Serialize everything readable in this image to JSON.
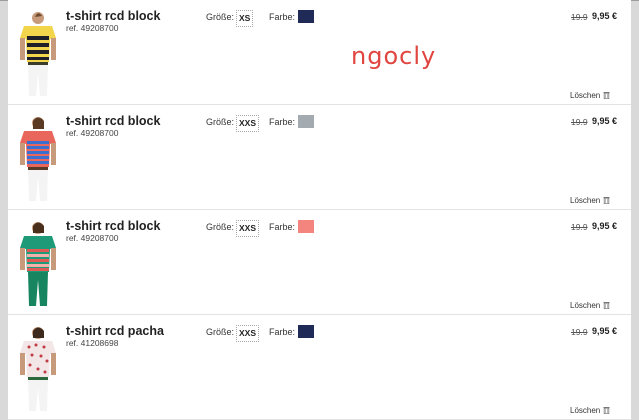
{
  "labels": {
    "size": "Größe:",
    "color": "Farbe:",
    "delete": "Löschen"
  },
  "watermark": "ngocly",
  "items": [
    {
      "name": "t-shirt rcd block",
      "ref": "ref. 49208700",
      "size": "XS",
      "color_hex": "#1f2a57",
      "old_price": "19.9",
      "new_price": "9,95 €",
      "shirt_colors": [
        "#f2d54a",
        "#1f1f2a"
      ]
    },
    {
      "name": "t-shirt rcd block",
      "ref": "ref. 49208700",
      "size": "XXS",
      "color_hex": "#a3abb1",
      "old_price": "19.9",
      "new_price": "9,95 €",
      "shirt_colors": [
        "#e8665b",
        "#3a6fd0"
      ]
    },
    {
      "name": "t-shirt rcd block",
      "ref": "ref. 49208700",
      "size": "XXS",
      "color_hex": "#f3857e",
      "old_price": "19.9",
      "new_price": "9,95 €",
      "shirt_colors": [
        "#1f9a78",
        "#e05a55"
      ]
    },
    {
      "name": "t-shirt rcd pacha",
      "ref": "ref. 41208698",
      "size": "XXS",
      "color_hex": "#1f2a57",
      "old_price": "19.9",
      "new_price": "9,95 €",
      "shirt_colors": [
        "#f2e6e6",
        "#c23a44"
      ]
    }
  ]
}
